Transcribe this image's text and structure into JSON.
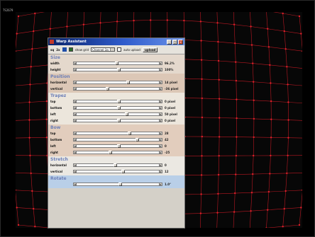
{
  "screen": {
    "corner_label": "TS2679",
    "grid_color": "#e0202a",
    "line_color": "#b81822"
  },
  "dialog": {
    "title": "Warp Assistant",
    "title_icon": "app-icon",
    "window_buttons": [
      "minimize-icon",
      "maximize-icon",
      "close-icon"
    ],
    "toolbar": {
      "btn_a": "sq",
      "btn_b": "2x",
      "save_icon": "save-icon",
      "show_grid_label": "show grid",
      "show_grid_checked": true,
      "channel_value": "Channel 3a",
      "auto_upload_label": "auto upload",
      "auto_upload_checked": false,
      "upload_label": "upload"
    },
    "groups": [
      {
        "title": "Size",
        "rows": [
          {
            "label": "width",
            "value": "96.2%",
            "level": 0.48
          },
          {
            "label": "height",
            "value": "100%",
            "level": 0.5
          }
        ]
      },
      {
        "title": "Position",
        "rows": [
          {
            "label": "horizontal",
            "value": "14 pixel",
            "level": 0.62
          },
          {
            "label": "vertical",
            "value": "-36 pixel",
            "level": 0.36
          }
        ]
      },
      {
        "title": "Trapez",
        "rows": [
          {
            "label": "top",
            "value": "0 pixel",
            "level": 0.5
          },
          {
            "label": "bottom",
            "value": "0 pixel",
            "level": 0.5
          },
          {
            "label": "left",
            "value": "50 pixel",
            "level": 0.6
          },
          {
            "label": "right",
            "value": "0 pixel",
            "level": 0.5
          }
        ]
      },
      {
        "title": "Bow",
        "rows": [
          {
            "label": "top",
            "value": "28",
            "level": 0.64
          },
          {
            "label": "bottom",
            "value": "42",
            "level": 0.74
          },
          {
            "label": "left",
            "value": "0",
            "level": 0.5
          },
          {
            "label": "right",
            "value": "-25",
            "level": 0.4
          }
        ]
      },
      {
        "title": "Stretch",
        "rows": [
          {
            "label": "horizontal",
            "value": "0",
            "level": 0.46
          },
          {
            "label": "vertical",
            "value": "12",
            "level": 0.56
          }
        ]
      },
      {
        "title": "Rotate",
        "rows": [
          {
            "label": "",
            "value": "1.0°",
            "level": 0.52
          }
        ]
      }
    ]
  }
}
